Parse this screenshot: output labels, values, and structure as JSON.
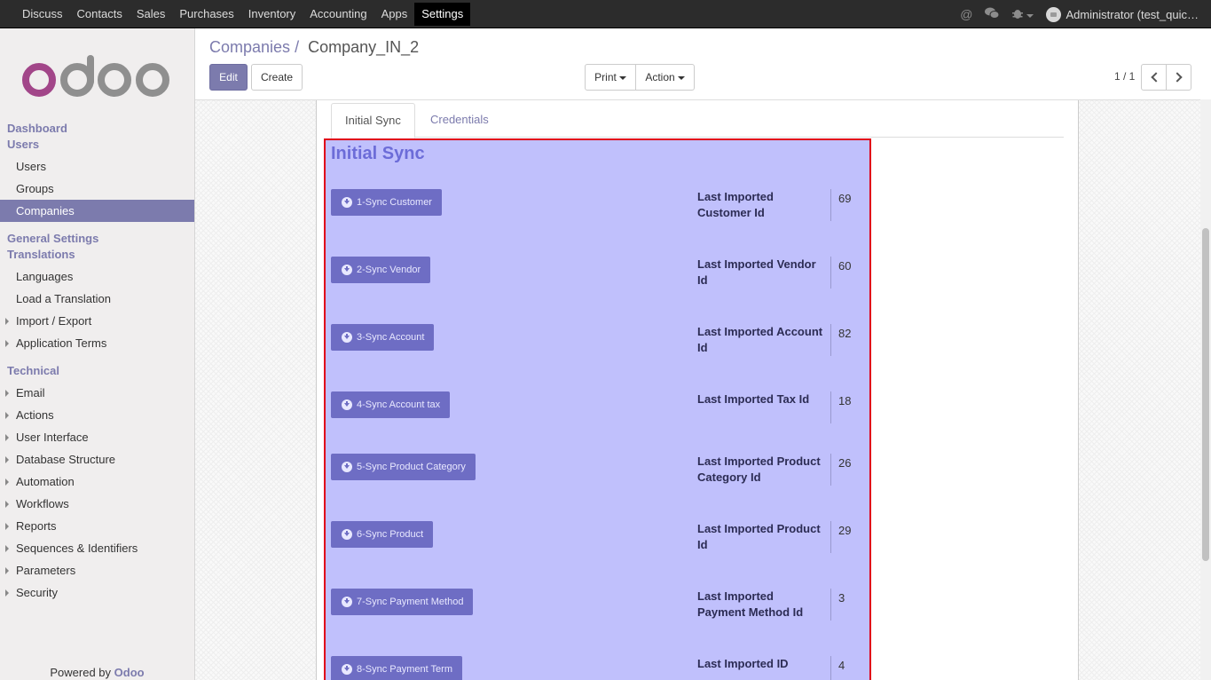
{
  "topbar": {
    "menu": [
      "Discuss",
      "Contacts",
      "Sales",
      "Purchases",
      "Inventory",
      "Accounting",
      "Apps",
      "Settings"
    ],
    "active": "Settings",
    "user_label": "Administrator (test_quic…"
  },
  "sidebar": {
    "sections": [
      {
        "title": "Dashboard",
        "items": []
      },
      {
        "title": "Users",
        "items": [
          {
            "label": "Users",
            "expandable": false
          },
          {
            "label": "Groups",
            "expandable": false
          },
          {
            "label": "Companies",
            "expandable": false,
            "active": true
          }
        ]
      },
      {
        "title": "General Settings",
        "items": []
      },
      {
        "title": "Translations",
        "items": [
          {
            "label": "Languages",
            "expandable": false
          },
          {
            "label": "Load a Translation",
            "expandable": false
          },
          {
            "label": "Import / Export",
            "expandable": true
          },
          {
            "label": "Application Terms",
            "expandable": true
          }
        ]
      },
      {
        "title": "Technical",
        "items": [
          {
            "label": "Email",
            "expandable": true
          },
          {
            "label": "Actions",
            "expandable": true
          },
          {
            "label": "User Interface",
            "expandable": true
          },
          {
            "label": "Database Structure",
            "expandable": true
          },
          {
            "label": "Automation",
            "expandable": true
          },
          {
            "label": "Workflows",
            "expandable": true
          },
          {
            "label": "Reports",
            "expandable": true
          },
          {
            "label": "Sequences & Identifiers",
            "expandable": true
          },
          {
            "label": "Parameters",
            "expandable": true
          },
          {
            "label": "Security",
            "expandable": true
          }
        ]
      }
    ],
    "powered_prefix": "Powered by ",
    "powered_brand": "Odoo"
  },
  "control_panel": {
    "breadcrumb_parent": "Companies",
    "breadcrumb_sep": "/",
    "breadcrumb_current": "Company_IN_2",
    "edit_label": "Edit",
    "create_label": "Create",
    "print_label": "Print",
    "action_label": "Action",
    "pager": "1 / 1"
  },
  "tabs": [
    "Initial Sync",
    "Credentials"
  ],
  "section_title": "Initial Sync",
  "sync_rows": [
    {
      "button": "1-Sync Customer",
      "label": "Last Imported Customer Id",
      "value": "69"
    },
    {
      "button": "2-Sync Vendor",
      "label": "Last Imported Vendor Id",
      "value": "60"
    },
    {
      "button": "3-Sync Account",
      "label": "Last Imported Account Id",
      "value": "82"
    },
    {
      "button": "4-Sync Account tax",
      "label": "Last Imported Tax Id",
      "value": "18"
    },
    {
      "button": "5-Sync Product Category",
      "label": "Last Imported Product Category Id",
      "value": "26"
    },
    {
      "button": "6-Sync Product",
      "label": "Last Imported Product Id",
      "value": "29"
    },
    {
      "button": "7-Sync Payment Method",
      "label": "Last Imported Payment Method Id",
      "value": "3"
    },
    {
      "button": "8-Sync Payment Term",
      "label": "Last Imported ID",
      "value": "4"
    }
  ],
  "colors": {
    "brand": "#7c7bad",
    "highlight": "#c0c0fc",
    "highlight_border": "#e0001a",
    "sync_button": "#6e6dc4"
  }
}
